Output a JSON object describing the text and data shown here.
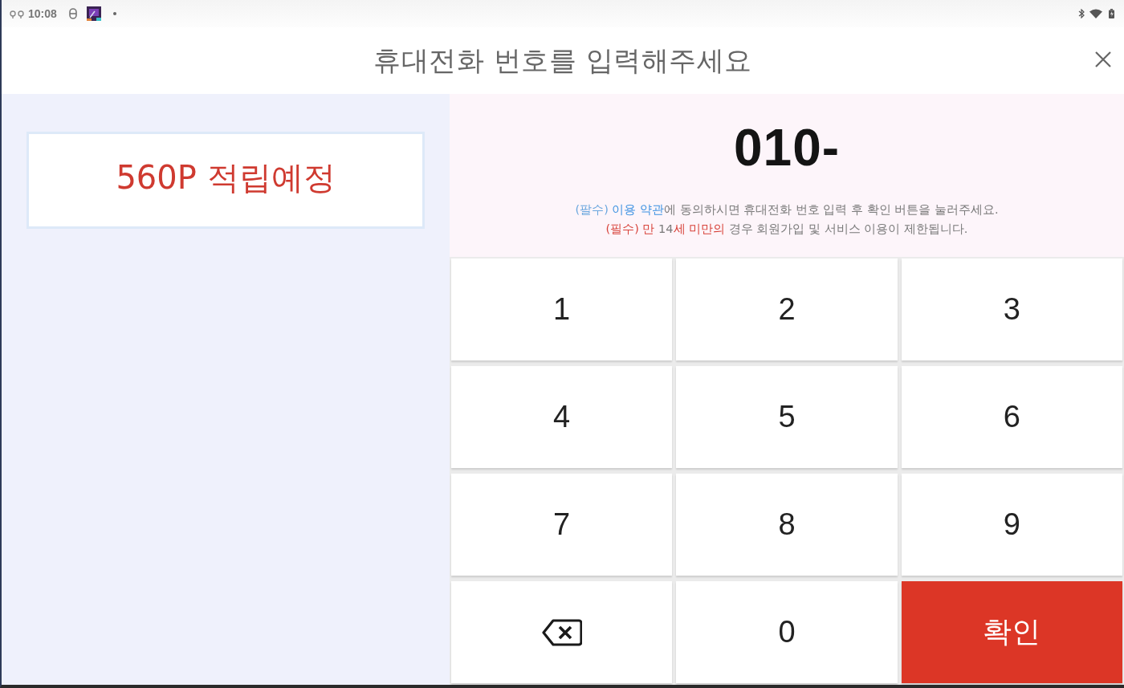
{
  "status_bar": {
    "time": "10:08"
  },
  "header": {
    "title": "휴대전화 번호를 입력해주세요"
  },
  "points_card": {
    "text": "560P 적립예정"
  },
  "phone_display": {
    "value": "010-"
  },
  "notices": [
    {
      "segments": [
        {
          "kind": "label",
          "text": "(팔수) "
        },
        {
          "kind": "link",
          "text": "이용 약관"
        },
        {
          "kind": "plain",
          "text": "에 동의하시면 휴대전화 번호 입력 후 확인 버튼을 눌러주세요."
        }
      ]
    },
    {
      "segments": [
        {
          "kind": "alert",
          "text": "(필수) 만 "
        },
        {
          "kind": "plain",
          "text": "14"
        },
        {
          "kind": "alert",
          "text": "세 미만의"
        },
        {
          "kind": "plain",
          "text": " 경우 회원가입 및 서비스 이용이 제한됩니다."
        }
      ]
    }
  ],
  "keypad": {
    "keys": [
      {
        "kind": "digit",
        "label": "1"
      },
      {
        "kind": "digit",
        "label": "2"
      },
      {
        "kind": "digit",
        "label": "3"
      },
      {
        "kind": "digit",
        "label": "4"
      },
      {
        "kind": "digit",
        "label": "5"
      },
      {
        "kind": "digit",
        "label": "6"
      },
      {
        "kind": "digit",
        "label": "7"
      },
      {
        "kind": "digit",
        "label": "8"
      },
      {
        "kind": "digit",
        "label": "9"
      },
      {
        "kind": "backspace"
      },
      {
        "kind": "digit",
        "label": "0"
      },
      {
        "kind": "confirm",
        "label": "확인"
      }
    ]
  }
}
